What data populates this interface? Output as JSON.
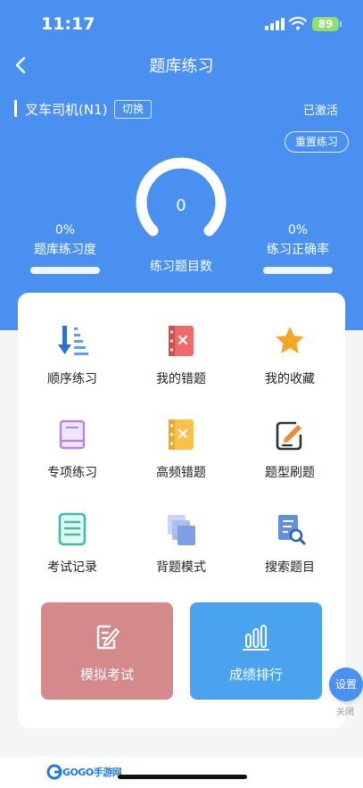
{
  "status_bar": {
    "time": "11:17",
    "battery": "89"
  },
  "nav": {
    "title": "题库练习"
  },
  "vehicle": {
    "name": "叉车司机(N1)",
    "switch_label": "切换",
    "status": "已激活"
  },
  "reset_label": "重置练习",
  "gauge": {
    "value": "0",
    "label": "练习题目数"
  },
  "stats": {
    "progress": {
      "percent": "0%",
      "label": "题库练习度",
      "value": 0
    },
    "accuracy": {
      "percent": "0%",
      "label": "练习正确率",
      "value": 0
    }
  },
  "grid": [
    {
      "label": "顺序练习",
      "icon": "sequence-icon"
    },
    {
      "label": "我的错题",
      "icon": "wrong-notebook-icon"
    },
    {
      "label": "我的收藏",
      "icon": "star-icon"
    },
    {
      "label": "专项练习",
      "icon": "book-icon"
    },
    {
      "label": "高频错题",
      "icon": "frequent-wrong-icon"
    },
    {
      "label": "题型刷题",
      "icon": "edit-icon"
    },
    {
      "label": "考试记录",
      "icon": "record-icon"
    },
    {
      "label": "背题模式",
      "icon": "cards-icon"
    },
    {
      "label": "搜索题目",
      "icon": "search-doc-icon"
    }
  ],
  "buttons": {
    "mock_exam": {
      "label": "模拟考试",
      "color": "#d4898b"
    },
    "ranking": {
      "label": "成绩排行",
      "color": "#4aa3ee"
    }
  },
  "float": {
    "settings_label": "设置",
    "close_label": "关闭"
  },
  "footer": {
    "logo": "GOGO手游网"
  },
  "colors": {
    "primary": "#4a90f0"
  }
}
